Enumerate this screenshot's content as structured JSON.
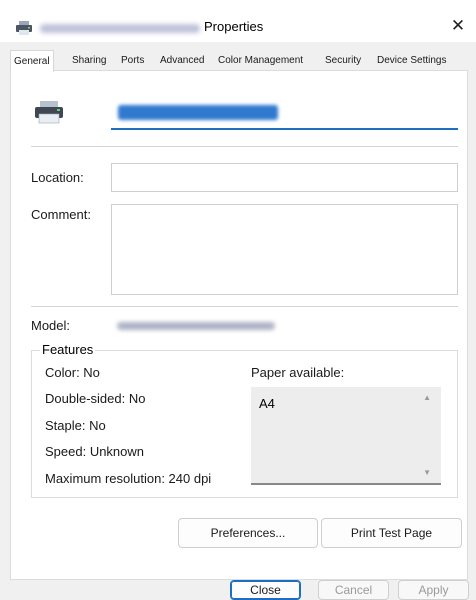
{
  "window": {
    "title": "Properties",
    "close_glyph": "✕"
  },
  "tabs": [
    {
      "label": "General"
    },
    {
      "label": "Sharing"
    },
    {
      "label": "Ports"
    },
    {
      "label": "Advanced"
    },
    {
      "label": "Color Management"
    },
    {
      "label": "Security"
    },
    {
      "label": "Device Settings"
    }
  ],
  "general": {
    "location_label": "Location:",
    "location_value": "",
    "comment_label": "Comment:",
    "comment_value": "",
    "model_label": "Model:"
  },
  "features": {
    "legend": "Features",
    "color": "Color: No",
    "double_sided": "Double-sided: No",
    "staple": "Staple: No",
    "speed": "Speed: Unknown",
    "max_resolution": "Maximum resolution: 240 dpi",
    "paper_label": "Paper available:",
    "paper_items": [
      "A4"
    ]
  },
  "buttons": {
    "preferences": "Preferences...",
    "print_test": "Print Test Page",
    "close": "Close",
    "cancel": "Cancel",
    "apply": "Apply"
  },
  "icons": {
    "title_icon": "printer-icon",
    "printer_icon": "printer-icon",
    "scroll_up": "▲",
    "scroll_down": "▼"
  }
}
